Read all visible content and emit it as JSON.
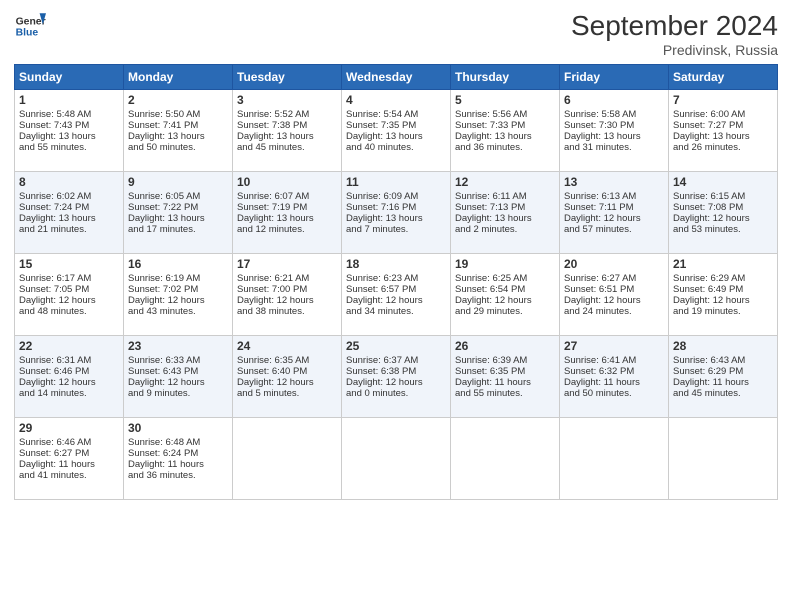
{
  "header": {
    "logo_line1": "General",
    "logo_line2": "Blue",
    "month": "September 2024",
    "location": "Predivinsk, Russia"
  },
  "weekdays": [
    "Sunday",
    "Monday",
    "Tuesday",
    "Wednesday",
    "Thursday",
    "Friday",
    "Saturday"
  ],
  "weeks": [
    [
      {
        "day": "1",
        "lines": [
          "Sunrise: 5:48 AM",
          "Sunset: 7:43 PM",
          "Daylight: 13 hours",
          "and 55 minutes."
        ]
      },
      {
        "day": "2",
        "lines": [
          "Sunrise: 5:50 AM",
          "Sunset: 7:41 PM",
          "Daylight: 13 hours",
          "and 50 minutes."
        ]
      },
      {
        "day": "3",
        "lines": [
          "Sunrise: 5:52 AM",
          "Sunset: 7:38 PM",
          "Daylight: 13 hours",
          "and 45 minutes."
        ]
      },
      {
        "day": "4",
        "lines": [
          "Sunrise: 5:54 AM",
          "Sunset: 7:35 PM",
          "Daylight: 13 hours",
          "and 40 minutes."
        ]
      },
      {
        "day": "5",
        "lines": [
          "Sunrise: 5:56 AM",
          "Sunset: 7:33 PM",
          "Daylight: 13 hours",
          "and 36 minutes."
        ]
      },
      {
        "day": "6",
        "lines": [
          "Sunrise: 5:58 AM",
          "Sunset: 7:30 PM",
          "Daylight: 13 hours",
          "and 31 minutes."
        ]
      },
      {
        "day": "7",
        "lines": [
          "Sunrise: 6:00 AM",
          "Sunset: 7:27 PM",
          "Daylight: 13 hours",
          "and 26 minutes."
        ]
      }
    ],
    [
      {
        "day": "8",
        "lines": [
          "Sunrise: 6:02 AM",
          "Sunset: 7:24 PM",
          "Daylight: 13 hours",
          "and 21 minutes."
        ]
      },
      {
        "day": "9",
        "lines": [
          "Sunrise: 6:05 AM",
          "Sunset: 7:22 PM",
          "Daylight: 13 hours",
          "and 17 minutes."
        ]
      },
      {
        "day": "10",
        "lines": [
          "Sunrise: 6:07 AM",
          "Sunset: 7:19 PM",
          "Daylight: 13 hours",
          "and 12 minutes."
        ]
      },
      {
        "day": "11",
        "lines": [
          "Sunrise: 6:09 AM",
          "Sunset: 7:16 PM",
          "Daylight: 13 hours",
          "and 7 minutes."
        ]
      },
      {
        "day": "12",
        "lines": [
          "Sunrise: 6:11 AM",
          "Sunset: 7:13 PM",
          "Daylight: 13 hours",
          "and 2 minutes."
        ]
      },
      {
        "day": "13",
        "lines": [
          "Sunrise: 6:13 AM",
          "Sunset: 7:11 PM",
          "Daylight: 12 hours",
          "and 57 minutes."
        ]
      },
      {
        "day": "14",
        "lines": [
          "Sunrise: 6:15 AM",
          "Sunset: 7:08 PM",
          "Daylight: 12 hours",
          "and 53 minutes."
        ]
      }
    ],
    [
      {
        "day": "15",
        "lines": [
          "Sunrise: 6:17 AM",
          "Sunset: 7:05 PM",
          "Daylight: 12 hours",
          "and 48 minutes."
        ]
      },
      {
        "day": "16",
        "lines": [
          "Sunrise: 6:19 AM",
          "Sunset: 7:02 PM",
          "Daylight: 12 hours",
          "and 43 minutes."
        ]
      },
      {
        "day": "17",
        "lines": [
          "Sunrise: 6:21 AM",
          "Sunset: 7:00 PM",
          "Daylight: 12 hours",
          "and 38 minutes."
        ]
      },
      {
        "day": "18",
        "lines": [
          "Sunrise: 6:23 AM",
          "Sunset: 6:57 PM",
          "Daylight: 12 hours",
          "and 34 minutes."
        ]
      },
      {
        "day": "19",
        "lines": [
          "Sunrise: 6:25 AM",
          "Sunset: 6:54 PM",
          "Daylight: 12 hours",
          "and 29 minutes."
        ]
      },
      {
        "day": "20",
        "lines": [
          "Sunrise: 6:27 AM",
          "Sunset: 6:51 PM",
          "Daylight: 12 hours",
          "and 24 minutes."
        ]
      },
      {
        "day": "21",
        "lines": [
          "Sunrise: 6:29 AM",
          "Sunset: 6:49 PM",
          "Daylight: 12 hours",
          "and 19 minutes."
        ]
      }
    ],
    [
      {
        "day": "22",
        "lines": [
          "Sunrise: 6:31 AM",
          "Sunset: 6:46 PM",
          "Daylight: 12 hours",
          "and 14 minutes."
        ]
      },
      {
        "day": "23",
        "lines": [
          "Sunrise: 6:33 AM",
          "Sunset: 6:43 PM",
          "Daylight: 12 hours",
          "and 9 minutes."
        ]
      },
      {
        "day": "24",
        "lines": [
          "Sunrise: 6:35 AM",
          "Sunset: 6:40 PM",
          "Daylight: 12 hours",
          "and 5 minutes."
        ]
      },
      {
        "day": "25",
        "lines": [
          "Sunrise: 6:37 AM",
          "Sunset: 6:38 PM",
          "Daylight: 12 hours",
          "and 0 minutes."
        ]
      },
      {
        "day": "26",
        "lines": [
          "Sunrise: 6:39 AM",
          "Sunset: 6:35 PM",
          "Daylight: 11 hours",
          "and 55 minutes."
        ]
      },
      {
        "day": "27",
        "lines": [
          "Sunrise: 6:41 AM",
          "Sunset: 6:32 PM",
          "Daylight: 11 hours",
          "and 50 minutes."
        ]
      },
      {
        "day": "28",
        "lines": [
          "Sunrise: 6:43 AM",
          "Sunset: 6:29 PM",
          "Daylight: 11 hours",
          "and 45 minutes."
        ]
      }
    ],
    [
      {
        "day": "29",
        "lines": [
          "Sunrise: 6:46 AM",
          "Sunset: 6:27 PM",
          "Daylight: 11 hours",
          "and 41 minutes."
        ]
      },
      {
        "day": "30",
        "lines": [
          "Sunrise: 6:48 AM",
          "Sunset: 6:24 PM",
          "Daylight: 11 hours",
          "and 36 minutes."
        ]
      },
      {
        "day": "",
        "lines": []
      },
      {
        "day": "",
        "lines": []
      },
      {
        "day": "",
        "lines": []
      },
      {
        "day": "",
        "lines": []
      },
      {
        "day": "",
        "lines": []
      }
    ]
  ]
}
